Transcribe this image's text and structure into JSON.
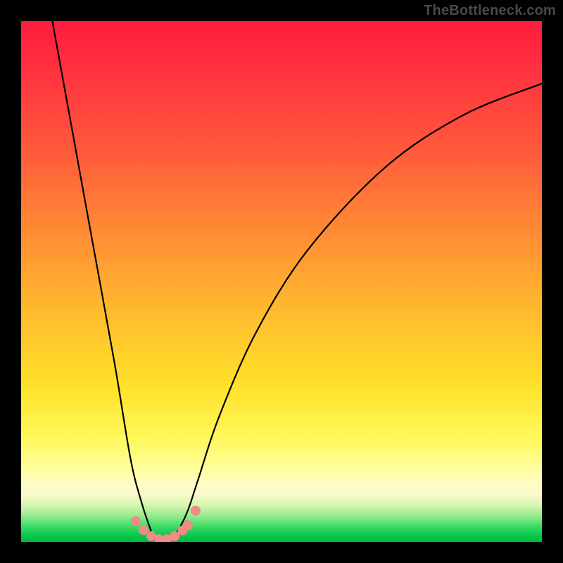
{
  "watermark": {
    "text": "TheBottleneck.com"
  },
  "chart_data": {
    "type": "line",
    "title": "",
    "xlabel": "",
    "ylabel": "",
    "xlim": [
      0,
      100
    ],
    "ylim": [
      0,
      100
    ],
    "grid": false,
    "legend": false,
    "gradient_stops": [
      {
        "pct": 0,
        "color": "#ff1c3e"
      },
      {
        "pct": 25,
        "color": "#ff5a3b"
      },
      {
        "pct": 55,
        "color": "#ffb82e"
      },
      {
        "pct": 80,
        "color": "#fff85a"
      },
      {
        "pct": 90,
        "color": "#fefcc9"
      },
      {
        "pct": 97,
        "color": "#3edb66"
      },
      {
        "pct": 100,
        "color": "#00b83e"
      }
    ],
    "series": [
      {
        "name": "bottleneck-curve",
        "type": "line",
        "x": [
          6,
          10,
          14,
          18,
          21,
          23,
          25,
          26,
          28,
          30,
          32,
          34,
          38,
          45,
          55,
          70,
          85,
          100
        ],
        "y": [
          100,
          78,
          56,
          34,
          16,
          8,
          2,
          0,
          0,
          2,
          6,
          12,
          24,
          40,
          56,
          72,
          82,
          88
        ]
      }
    ],
    "markers": {
      "name": "bottom-cluster",
      "x": [
        22,
        23.5,
        25,
        26.5,
        28,
        29.5,
        31,
        32,
        33.5
      ],
      "y": [
        4,
        2.3,
        1.1,
        0.5,
        0.5,
        1.1,
        2.2,
        3.2,
        6
      ],
      "color": "#f28a86",
      "radius_px": 7
    }
  }
}
